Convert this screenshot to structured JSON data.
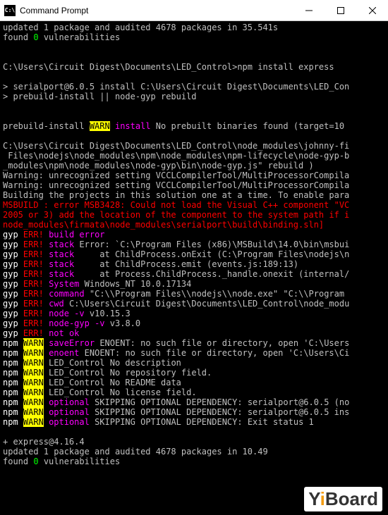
{
  "titlebar": {
    "icon_text": "C:\\",
    "title": "Command Prompt"
  },
  "lines": [
    {
      "segs": [
        {
          "t": "updated 1 package and audited 4678 packages in 35.541s"
        }
      ]
    },
    {
      "segs": [
        {
          "t": "found "
        },
        {
          "t": "0",
          "c": "green"
        },
        {
          "t": " vulnerabilities"
        }
      ]
    },
    {
      "segs": [
        {
          "t": " "
        }
      ]
    },
    {
      "segs": [
        {
          "t": " "
        }
      ]
    },
    {
      "segs": [
        {
          "t": "C:\\Users\\Circuit Digest\\Documents\\LED_Control>npm install express"
        }
      ]
    },
    {
      "segs": [
        {
          "t": " "
        }
      ]
    },
    {
      "segs": [
        {
          "t": "> serialport@6.0.5 install C:\\Users\\Circuit Digest\\Documents\\LED_Con"
        }
      ]
    },
    {
      "segs": [
        {
          "t": "> prebuild-install || node-gyp rebuild"
        }
      ]
    },
    {
      "segs": [
        {
          "t": " "
        }
      ]
    },
    {
      "segs": [
        {
          "t": " "
        }
      ]
    },
    {
      "segs": [
        {
          "t": "prebuild-install "
        },
        {
          "t": "WARN",
          "c": "yellow-bg"
        },
        {
          "t": " "
        },
        {
          "t": "install",
          "c": "magenta"
        },
        {
          "t": " No prebuilt binaries found (target=10"
        }
      ]
    },
    {
      "segs": [
        {
          "t": " "
        }
      ]
    },
    {
      "segs": [
        {
          "t": "C:\\Users\\Circuit Digest\\Documents\\LED_Control\\node_modules\\johnny-fi"
        }
      ]
    },
    {
      "segs": [
        {
          "t": " Files\\nodejs\\node_modules\\npm\\node_modules\\npm-lifecycle\\node-gyp-b"
        }
      ]
    },
    {
      "segs": [
        {
          "t": "_modules\\npm\\node_modules\\node-gyp\\bin\\node-gyp.js\" rebuild )"
        }
      ]
    },
    {
      "segs": [
        {
          "t": "Warning: unrecognized setting VCCLCompilerTool/MultiProcessorCompila"
        }
      ]
    },
    {
      "segs": [
        {
          "t": "Warning: unrecognized setting VCCLCompilerTool/MultiProcessorCompila"
        }
      ]
    },
    {
      "segs": [
        {
          "t": "Building the projects in this solution one at a time. To enable para"
        }
      ]
    },
    {
      "segs": [
        {
          "t": "MSBUILD : error MSB3428: Could not load the Visual C++ component \"VC",
          "c": "red"
        }
      ]
    },
    {
      "segs": [
        {
          "t": "2005 or 3) add the location of the component to the system path if i",
          "c": "red"
        }
      ]
    },
    {
      "segs": [
        {
          "t": "node_modules\\firmata\\node_modules\\serialport\\build\\binding.sln]",
          "c": "red"
        }
      ]
    },
    {
      "segs": [
        {
          "t": "gyp",
          "c": "white"
        },
        {
          "t": " "
        },
        {
          "t": "ERR!",
          "c": "red"
        },
        {
          "t": " "
        },
        {
          "t": "build error",
          "c": "magenta"
        }
      ]
    },
    {
      "segs": [
        {
          "t": "gyp",
          "c": "white"
        },
        {
          "t": " "
        },
        {
          "t": "ERR!",
          "c": "red"
        },
        {
          "t": " "
        },
        {
          "t": "stack",
          "c": "magenta"
        },
        {
          "t": " Error: `C:\\Program Files (x86)\\MSBuild\\14.0\\bin\\msbui"
        }
      ]
    },
    {
      "segs": [
        {
          "t": "gyp",
          "c": "white"
        },
        {
          "t": " "
        },
        {
          "t": "ERR!",
          "c": "red"
        },
        {
          "t": " "
        },
        {
          "t": "stack",
          "c": "magenta"
        },
        {
          "t": "     at ChildProcess.onExit (C:\\Program Files\\nodejs\\n"
        }
      ]
    },
    {
      "segs": [
        {
          "t": "gyp",
          "c": "white"
        },
        {
          "t": " "
        },
        {
          "t": "ERR!",
          "c": "red"
        },
        {
          "t": " "
        },
        {
          "t": "stack",
          "c": "magenta"
        },
        {
          "t": "     at ChildProcess.emit (events.js:189:13)"
        }
      ]
    },
    {
      "segs": [
        {
          "t": "gyp",
          "c": "white"
        },
        {
          "t": " "
        },
        {
          "t": "ERR!",
          "c": "red"
        },
        {
          "t": " "
        },
        {
          "t": "stack",
          "c": "magenta"
        },
        {
          "t": "     at Process.ChildProcess._handle.onexit (internal/"
        }
      ]
    },
    {
      "segs": [
        {
          "t": "gyp",
          "c": "white"
        },
        {
          "t": " "
        },
        {
          "t": "ERR!",
          "c": "red"
        },
        {
          "t": " "
        },
        {
          "t": "System",
          "c": "magenta"
        },
        {
          "t": " Windows_NT 10.0.17134"
        }
      ]
    },
    {
      "segs": [
        {
          "t": "gyp",
          "c": "white"
        },
        {
          "t": " "
        },
        {
          "t": "ERR!",
          "c": "red"
        },
        {
          "t": " "
        },
        {
          "t": "command",
          "c": "magenta"
        },
        {
          "t": " \"C:\\\\Program Files\\\\nodejs\\\\node.exe\" \"C:\\\\Program "
        }
      ]
    },
    {
      "segs": [
        {
          "t": "gyp",
          "c": "white"
        },
        {
          "t": " "
        },
        {
          "t": "ERR!",
          "c": "red"
        },
        {
          "t": " "
        },
        {
          "t": "cwd",
          "c": "magenta"
        },
        {
          "t": " C:\\Users\\Circuit Digest\\Documents\\LED_Control\\node_modu"
        }
      ]
    },
    {
      "segs": [
        {
          "t": "gyp",
          "c": "white"
        },
        {
          "t": " "
        },
        {
          "t": "ERR!",
          "c": "red"
        },
        {
          "t": " "
        },
        {
          "t": "node -v",
          "c": "magenta"
        },
        {
          "t": " v10.15.3"
        }
      ]
    },
    {
      "segs": [
        {
          "t": "gyp",
          "c": "white"
        },
        {
          "t": " "
        },
        {
          "t": "ERR!",
          "c": "red"
        },
        {
          "t": " "
        },
        {
          "t": "node-gyp -v",
          "c": "magenta"
        },
        {
          "t": " v3.8.0"
        }
      ]
    },
    {
      "segs": [
        {
          "t": "gyp",
          "c": "white"
        },
        {
          "t": " "
        },
        {
          "t": "ERR!",
          "c": "red"
        },
        {
          "t": " "
        },
        {
          "t": "not ok",
          "c": "magenta"
        }
      ]
    },
    {
      "segs": [
        {
          "t": "npm",
          "c": "white"
        },
        {
          "t": " "
        },
        {
          "t": "WARN",
          "c": "yellow-bg"
        },
        {
          "t": " "
        },
        {
          "t": "saveError",
          "c": "magenta"
        },
        {
          "t": " ENOENT: no such file or directory, open 'C:\\Users"
        }
      ]
    },
    {
      "segs": [
        {
          "t": "npm",
          "c": "white"
        },
        {
          "t": " "
        },
        {
          "t": "WARN",
          "c": "yellow-bg"
        },
        {
          "t": " "
        },
        {
          "t": "enoent",
          "c": "magenta"
        },
        {
          "t": " ENOENT: no such file or directory, open 'C:\\Users\\Ci"
        }
      ]
    },
    {
      "segs": [
        {
          "t": "npm",
          "c": "white"
        },
        {
          "t": " "
        },
        {
          "t": "WARN",
          "c": "yellow-bg"
        },
        {
          "t": " LED_Control No description"
        }
      ]
    },
    {
      "segs": [
        {
          "t": "npm",
          "c": "white"
        },
        {
          "t": " "
        },
        {
          "t": "WARN",
          "c": "yellow-bg"
        },
        {
          "t": " LED_Control No repository field."
        }
      ]
    },
    {
      "segs": [
        {
          "t": "npm",
          "c": "white"
        },
        {
          "t": " "
        },
        {
          "t": "WARN",
          "c": "yellow-bg"
        },
        {
          "t": " LED_Control No README data"
        }
      ]
    },
    {
      "segs": [
        {
          "t": "npm",
          "c": "white"
        },
        {
          "t": " "
        },
        {
          "t": "WARN",
          "c": "yellow-bg"
        },
        {
          "t": " LED_Control No license field."
        }
      ]
    },
    {
      "segs": [
        {
          "t": "npm",
          "c": "white"
        },
        {
          "t": " "
        },
        {
          "t": "WARN",
          "c": "yellow-bg"
        },
        {
          "t": " "
        },
        {
          "t": "optional",
          "c": "magenta"
        },
        {
          "t": " SKIPPING OPTIONAL DEPENDENCY: serialport@6.0.5 (no"
        }
      ]
    },
    {
      "segs": [
        {
          "t": "npm",
          "c": "white"
        },
        {
          "t": " "
        },
        {
          "t": "WARN",
          "c": "yellow-bg"
        },
        {
          "t": " "
        },
        {
          "t": "optional",
          "c": "magenta"
        },
        {
          "t": " SKIPPING OPTIONAL DEPENDENCY: serialport@6.0.5 ins"
        }
      ]
    },
    {
      "segs": [
        {
          "t": "npm",
          "c": "white"
        },
        {
          "t": " "
        },
        {
          "t": "WARN",
          "c": "yellow-bg"
        },
        {
          "t": " "
        },
        {
          "t": "optional",
          "c": "magenta"
        },
        {
          "t": " SKIPPING OPTIONAL DEPENDENCY: Exit status 1"
        }
      ]
    },
    {
      "segs": [
        {
          "t": " "
        }
      ]
    },
    {
      "segs": [
        {
          "t": "+ express@4.16.4"
        }
      ]
    },
    {
      "segs": [
        {
          "t": "updated 1 package and audited 4678 packages in 10.49"
        }
      ]
    },
    {
      "segs": [
        {
          "t": "found "
        },
        {
          "t": "0",
          "c": "green"
        },
        {
          "t": " vulnerabilities"
        }
      ]
    }
  ],
  "watermark": {
    "pre": "Y",
    "i": "i",
    "post": "Board"
  }
}
